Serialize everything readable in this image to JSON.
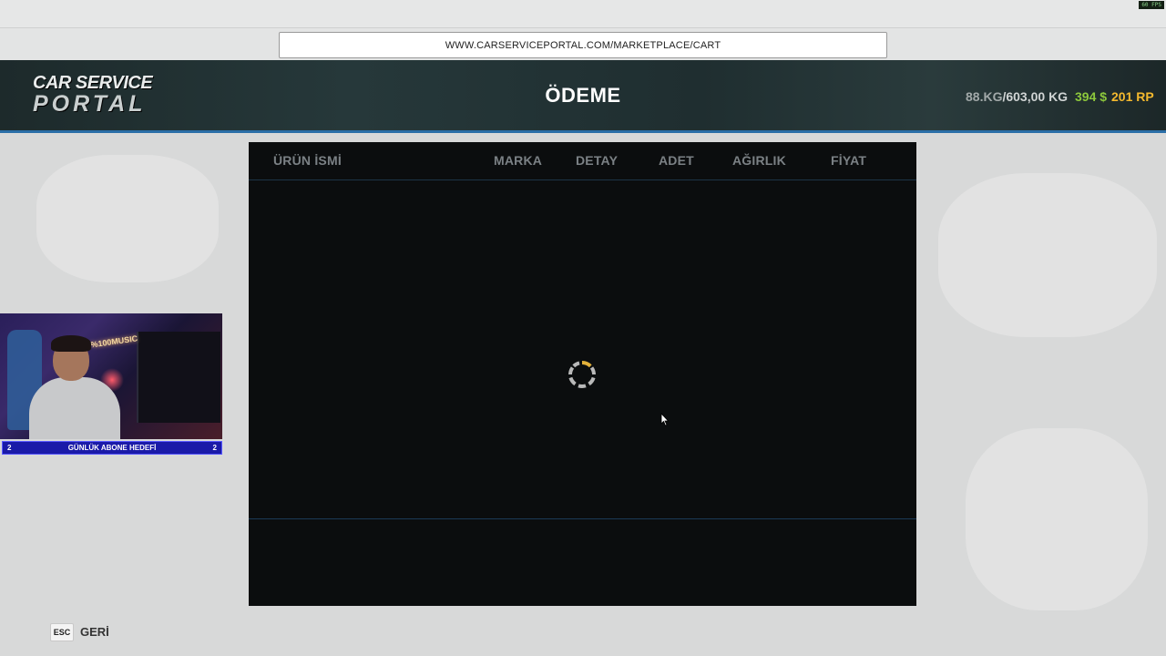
{
  "overlay": {
    "fps_label": "60 FPS"
  },
  "browser": {
    "url": "WWW.CARSERVICEPORTAL.COM/MARKETPLACE/CART"
  },
  "header": {
    "logo_line1": "CAR SERVICE",
    "logo_line2": "PORTAL",
    "title": "ÖDEME",
    "weight_current": "88.KG",
    "weight_max": "/603,00 KG",
    "money": "394 $",
    "rp": "201 RP"
  },
  "cart": {
    "columns": [
      "ÜRÜN İSMİ",
      "MARKA",
      "DETAY",
      "ADET",
      "AĞIRLIK",
      "FİYAT"
    ],
    "rows": [],
    "state": "loading"
  },
  "stream": {
    "webcam_sign": "%100MUSIC",
    "goal_left": "2",
    "goal_label": "GÜNLÜK ABONE HEDEFİ",
    "goal_right": "2"
  },
  "footer": {
    "esc_key": "ESC",
    "back_label": "GERİ"
  },
  "colors": {
    "accent_blue": "#2b6fa8",
    "money_green": "#8dc83c",
    "rp_gold": "#f4b92e",
    "panel_bg": "#0b0d0e"
  }
}
